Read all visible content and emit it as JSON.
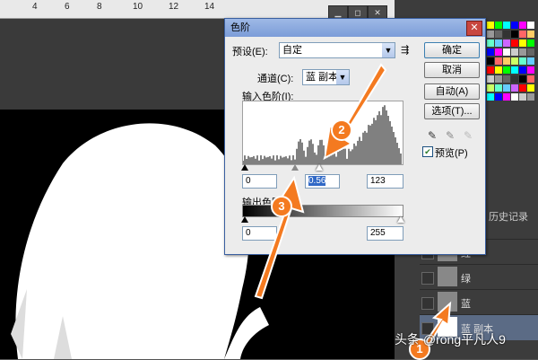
{
  "ruler": {
    "numbers": [
      "4",
      "6",
      "8",
      "10",
      "12",
      "14"
    ]
  },
  "dialog": {
    "title": "色阶",
    "preset_label": "预设(E):",
    "preset_value": "自定",
    "channel_label": "通道(C):",
    "channel_value": "蓝 副本",
    "input_levels_label": "输入色阶(I):",
    "input_black": "0",
    "input_gamma": "0.56",
    "input_white": "123",
    "output_levels_label": "输出色阶(O):",
    "output_black": "0",
    "output_white": "255",
    "buttons": {
      "ok": "确定",
      "cancel": "取消",
      "auto": "自动(A)",
      "options": "选项(T)..."
    },
    "preview_label": "预览(P)",
    "preview_checked": true
  },
  "layers": [
    {
      "name": "红",
      "selected": false
    },
    {
      "name": "绿",
      "selected": false
    },
    {
      "name": "蓝",
      "selected": false
    },
    {
      "name": "蓝 副本",
      "selected": true
    }
  ],
  "history_tab": "历史记录",
  "annotations": [
    "1",
    "2",
    "3"
  ],
  "watermark": "头条 @rong平凡人9",
  "colors": {
    "annotation": "#f47a20",
    "title_bar": "#7b9cd8",
    "selected_layer": "#5b6b85"
  }
}
